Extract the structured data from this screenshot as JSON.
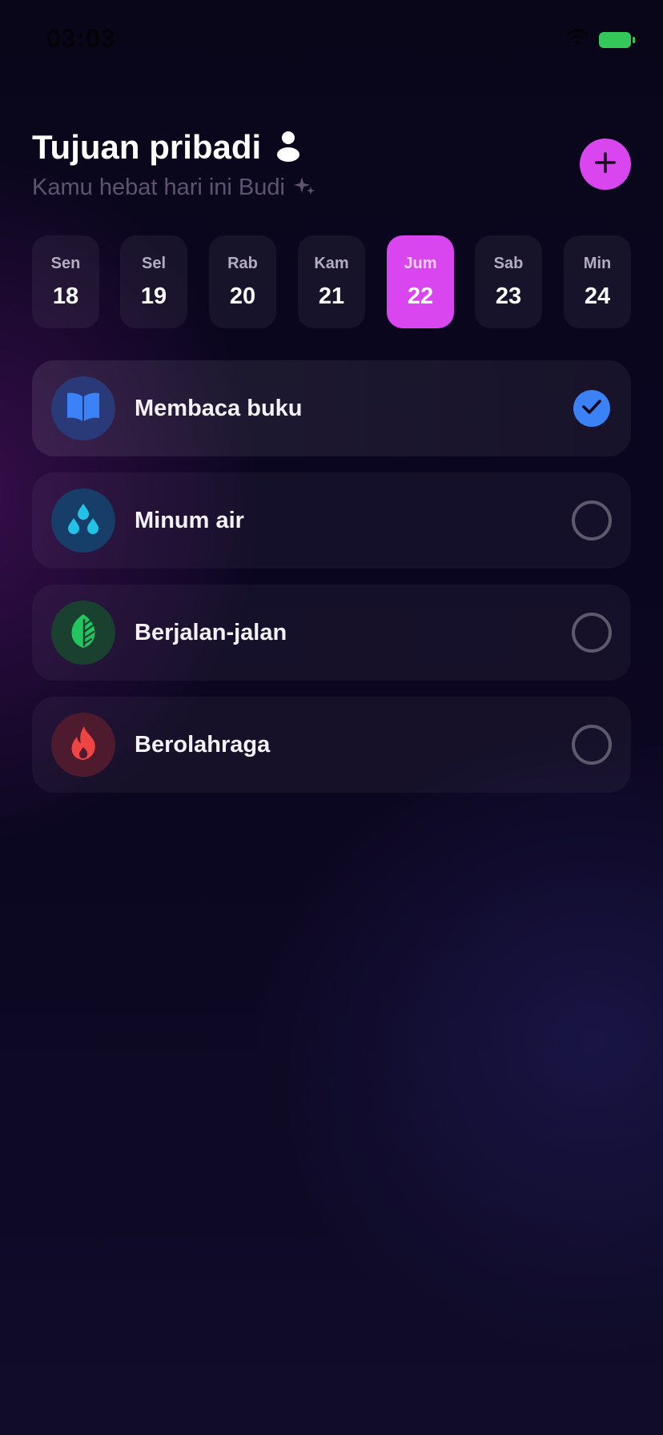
{
  "status_bar": {
    "time": "03:03"
  },
  "header": {
    "title": "Tujuan pribadi",
    "subtitle": "Kamu hebat hari ini Budi",
    "title_icon": "person-icon",
    "subtitle_icon": "sparkles-icon",
    "add_icon": "plus-icon"
  },
  "colors": {
    "accent": "#d946ef",
    "check_done": "#3b82f6"
  },
  "days": [
    {
      "name": "Sen",
      "num": "18",
      "selected": false
    },
    {
      "name": "Sel",
      "num": "19",
      "selected": false
    },
    {
      "name": "Rab",
      "num": "20",
      "selected": false
    },
    {
      "name": "Kam",
      "num": "21",
      "selected": false
    },
    {
      "name": "Jum",
      "num": "22",
      "selected": true
    },
    {
      "name": "Sab",
      "num": "23",
      "selected": false
    },
    {
      "name": "Min",
      "num": "24",
      "selected": false
    }
  ],
  "goals": [
    {
      "label": "Membaca buku",
      "icon": "book-icon",
      "icon_color": "#3b82f6",
      "icon_bg": "#2a3a78",
      "done": true
    },
    {
      "label": "Minum air",
      "icon": "water-drops-icon",
      "icon_color": "#22c2e6",
      "icon_bg": "#163e68",
      "done": false
    },
    {
      "label": "Berjalan-jalan",
      "icon": "leaf-icon",
      "icon_color": "#22c55e",
      "icon_bg": "#1a4030",
      "done": false
    },
    {
      "label": "Berolahraga",
      "icon": "fire-icon",
      "icon_color": "#ef4444",
      "icon_bg": "#4d1a2e",
      "done": false
    }
  ]
}
